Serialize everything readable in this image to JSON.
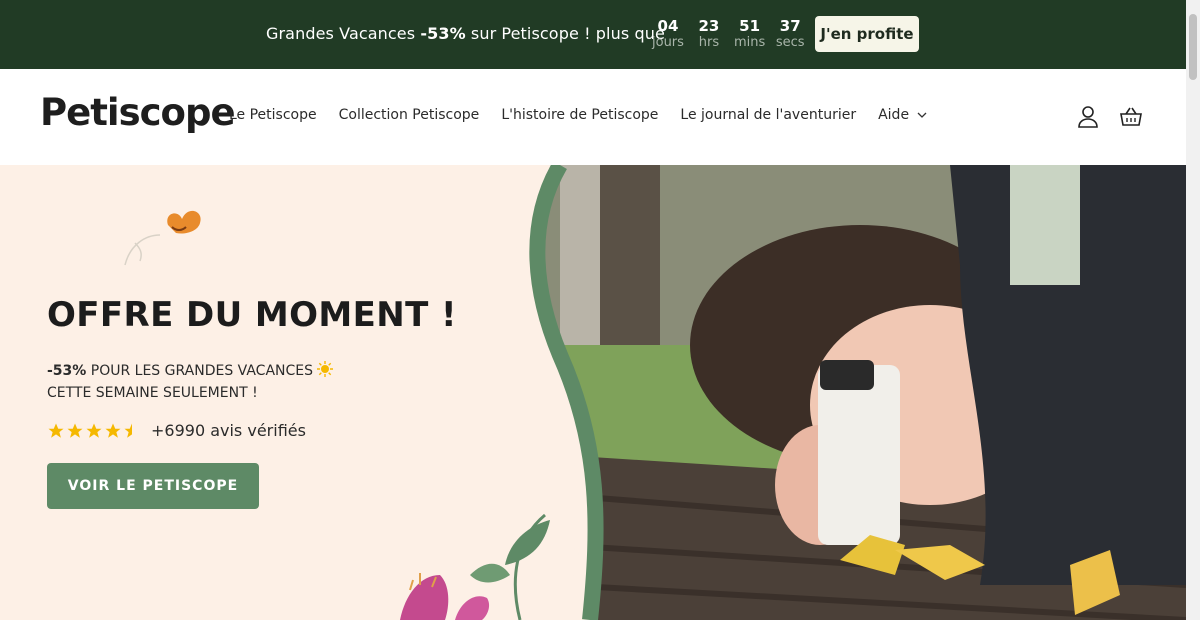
{
  "announcement": {
    "text_before": "Grandes Vacances ",
    "discount": "-53%",
    "text_after": " sur Petiscope ! plus que",
    "countdown": [
      {
        "value": "04",
        "label": "jours"
      },
      {
        "value": "23",
        "label": "hrs"
      },
      {
        "value": "51",
        "label": "mins"
      },
      {
        "value": "37",
        "label": "secs"
      }
    ],
    "cta_label": "J'en profite"
  },
  "header": {
    "logo_text": "Petiscope",
    "nav": [
      {
        "label": "Le Petiscope"
      },
      {
        "label": "Collection Petiscope"
      },
      {
        "label": "L'histoire de Petiscope"
      },
      {
        "label": "Le journal de l'aventurier"
      },
      {
        "label": "Aide"
      }
    ],
    "icons": [
      "account-icon",
      "cart-icon"
    ]
  },
  "hero": {
    "title": "OFFRE DU MOMENT !",
    "subtitle_discount": "-53%",
    "subtitle_line1_rest": " POUR LES GRANDES VACANCES",
    "subtitle_line2": "CETTE SEMAINE SEULEMENT !",
    "rating_stars": 4.5,
    "reviews_text": "+6990 avis vérifiés",
    "cta_label": "VOIR LE PETISCOPE"
  },
  "colors": {
    "topbar_bg": "#213b25",
    "hero_bg": "#fdf0e6",
    "accent_green": "#5e8a66",
    "star": "#f5b800"
  }
}
